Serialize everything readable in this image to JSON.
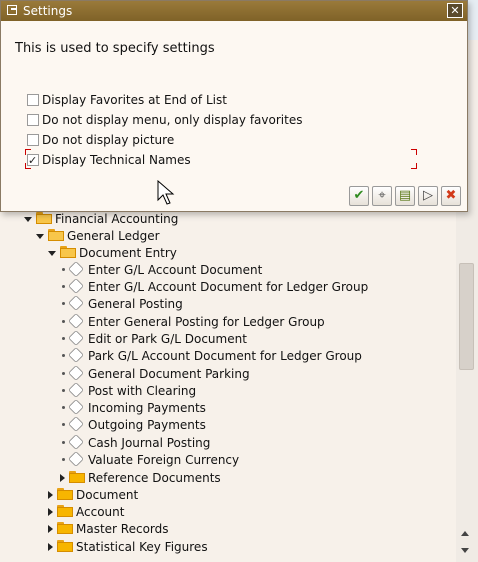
{
  "dialog": {
    "title": "Settings",
    "close_glyph": "✕",
    "description": "This is used to specify settings",
    "options": [
      {
        "label": "Display Favorites at End of List",
        "checked": false
      },
      {
        "label": "Do not display menu, only display favorites",
        "checked": false
      },
      {
        "label": "Do not display picture",
        "checked": false
      },
      {
        "label": "Display Technical Names",
        "checked": true
      }
    ],
    "buttons": [
      {
        "name": "confirm-button",
        "glyph": "✔",
        "color": "#2e8b1f"
      },
      {
        "name": "find-button",
        "glyph": "⌖",
        "color": "#555555"
      },
      {
        "name": "export-button",
        "glyph": "▤",
        "color": "#5b7a1a"
      },
      {
        "name": "navigate-button",
        "glyph": "▷",
        "color": "#444444"
      },
      {
        "name": "cancel-button",
        "glyph": "✖",
        "color": "#d23a1a"
      }
    ]
  },
  "tree": {
    "rows": [
      {
        "label": "Financial Accounting",
        "type": "folder",
        "expanded": true
      },
      {
        "label": "General Ledger",
        "type": "folder",
        "expanded": true
      },
      {
        "label": "Document Entry",
        "type": "folder",
        "expanded": true
      },
      {
        "label": "Enter G/L Account Document",
        "type": "transaction"
      },
      {
        "label": "Enter G/L Account Document for Ledger Group",
        "type": "transaction"
      },
      {
        "label": "General Posting",
        "type": "transaction"
      },
      {
        "label": "Enter General Posting for Ledger Group",
        "type": "transaction"
      },
      {
        "label": "Edit or Park G/L Document",
        "type": "transaction"
      },
      {
        "label": "Park G/L Account Document for Ledger Group",
        "type": "transaction"
      },
      {
        "label": "General Document Parking",
        "type": "transaction"
      },
      {
        "label": "Post with Clearing",
        "type": "transaction"
      },
      {
        "label": "Incoming Payments",
        "type": "transaction"
      },
      {
        "label": "Outgoing Payments",
        "type": "transaction"
      },
      {
        "label": "Cash Journal Posting",
        "type": "transaction"
      },
      {
        "label": "Valuate Foreign Currency",
        "type": "transaction"
      },
      {
        "label": "Reference Documents",
        "type": "folder",
        "expanded": false
      },
      {
        "label": "Document",
        "type": "folder",
        "expanded": false
      },
      {
        "label": "Account",
        "type": "folder",
        "expanded": false
      },
      {
        "label": "Master Records",
        "type": "folder",
        "expanded": false
      },
      {
        "label": "Statistical Key Figures",
        "type": "folder",
        "expanded": false
      }
    ]
  }
}
